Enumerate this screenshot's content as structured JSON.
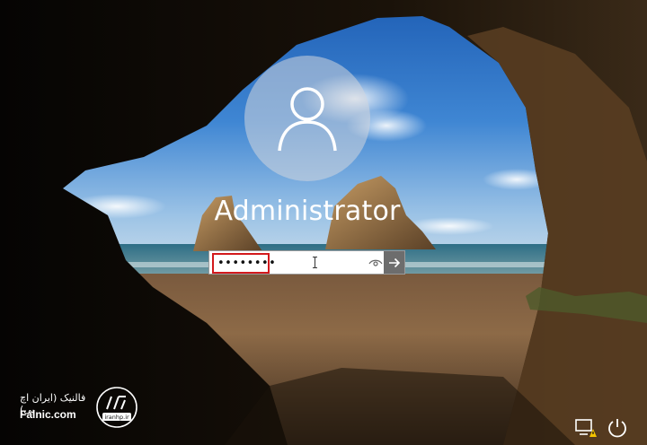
{
  "user": {
    "display_name": "Administrator",
    "avatar_icon": "user-silhouette-icon"
  },
  "password": {
    "value": "••••••••",
    "reveal_icon": "eye-icon",
    "submit_icon": "arrow-right-icon"
  },
  "brand": {
    "name_fa": "فالنیک (ایران اچ پی)",
    "name_en": "Falnic.com",
    "logo_text": "iranhp.ir",
    "logo_icon": "hp-logo-icon"
  },
  "system_tray": {
    "network_icon": "network-warning-icon",
    "power_icon": "power-icon"
  },
  "colors": {
    "avatar_bg": "#d2d6dc",
    "highlight_border": "#d3191c",
    "submit_bg": "#6d6d6d",
    "warning": "#f5c400"
  }
}
